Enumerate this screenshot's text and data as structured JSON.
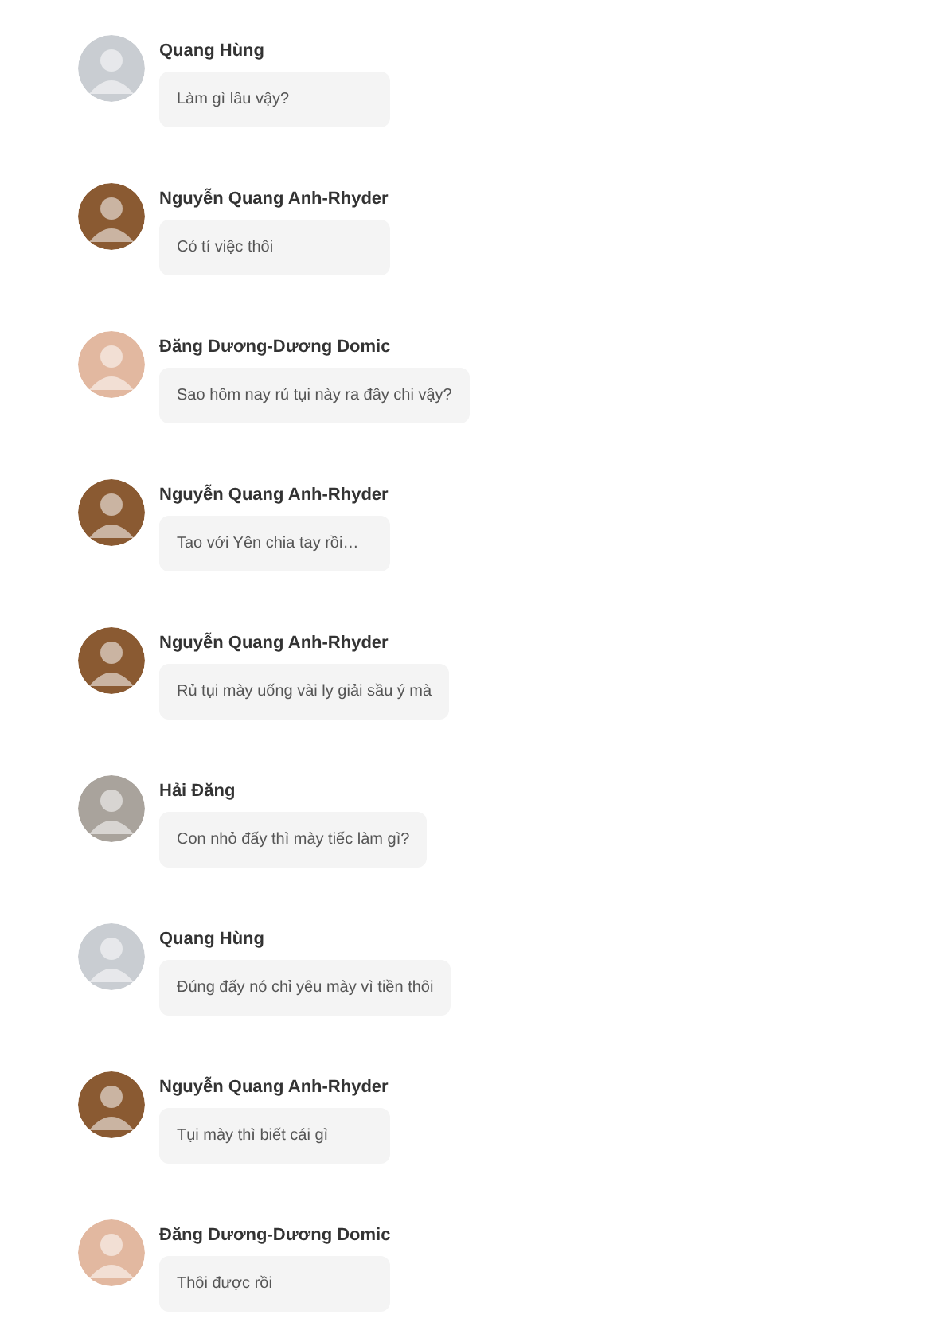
{
  "messages": [
    {
      "sender": "Quang Hùng",
      "text": "Làm gì lâu vậy?",
      "color": "#c9cdd2"
    },
    {
      "sender": "Nguyễn Quang Anh-Rhyder",
      "text": "Có tí việc thôi",
      "color": "#8a5a32"
    },
    {
      "sender": "Đăng Dương-Dương Domic",
      "text": "Sao hôm nay rủ tụi này ra đây chi vậy?",
      "color": "#e2b8a0"
    },
    {
      "sender": "Nguyễn Quang Anh-Rhyder",
      "text": "Tao với Yên chia tay rồi…",
      "color": "#8a5a32"
    },
    {
      "sender": "Nguyễn Quang Anh-Rhyder",
      "text": "Rủ tụi mày uống vài ly giải sầu ý mà",
      "color": "#8a5a32"
    },
    {
      "sender": "Hải Đăng",
      "text": "Con nhỏ đấy thì mày tiếc làm gì?",
      "color": "#a9a39c"
    },
    {
      "sender": "Quang Hùng",
      "text": "Đúng đấy nó chỉ yêu mày vì tiền thôi",
      "color": "#c9cdd2"
    },
    {
      "sender": "Nguyễn Quang Anh-Rhyder",
      "text": "Tụi mày thì biết cái gì",
      "color": "#8a5a32"
    },
    {
      "sender": "Đăng Dương-Dương Domic",
      "text": "Thôi được rồi",
      "color": "#e2b8a0"
    }
  ]
}
